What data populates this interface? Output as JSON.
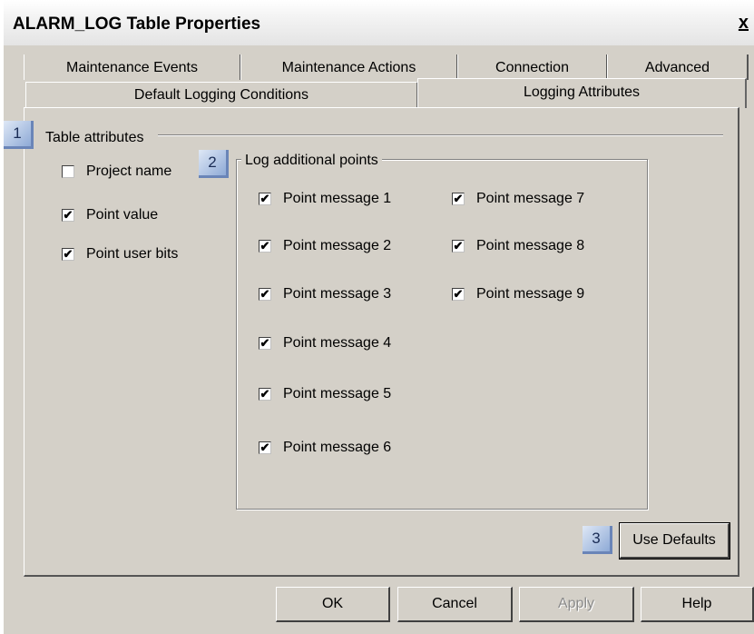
{
  "window": {
    "title": "ALARM_LOG Table Properties",
    "close_label": "x"
  },
  "tabs_back": [
    "Maintenance Events",
    "Maintenance Actions",
    "Connection",
    "Advanced"
  ],
  "tabs_front": [
    "Default Logging Conditions",
    "Logging Attributes"
  ],
  "active_tab": "Logging Attributes",
  "badges": [
    "1",
    "2",
    "3"
  ],
  "table_attributes": {
    "label": "Table attributes",
    "items": [
      {
        "label": "Project name",
        "checked": false
      },
      {
        "label": "Point value",
        "checked": true
      },
      {
        "label": "Point user bits",
        "checked": true
      }
    ]
  },
  "log_additional_points": {
    "label": "Log additional points",
    "items": [
      {
        "label": "Point message 1",
        "checked": true
      },
      {
        "label": "Point message 2",
        "checked": true
      },
      {
        "label": "Point message 3",
        "checked": true
      },
      {
        "label": "Point message 4",
        "checked": true
      },
      {
        "label": "Point message 5",
        "checked": true
      },
      {
        "label": "Point message 6",
        "checked": true
      },
      {
        "label": "Point message 7",
        "checked": true
      },
      {
        "label": "Point message 8",
        "checked": true
      },
      {
        "label": "Point message 9",
        "checked": true
      }
    ]
  },
  "use_defaults_label": "Use Defaults",
  "buttons": {
    "ok": "OK",
    "cancel": "Cancel",
    "apply": "Apply",
    "help": "Help"
  },
  "check_glyph": "✔"
}
